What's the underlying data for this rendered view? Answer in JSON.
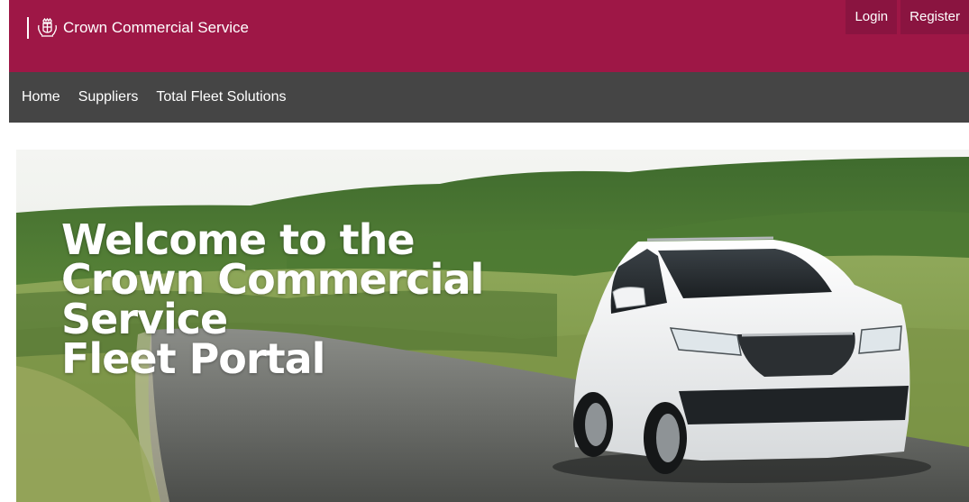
{
  "header": {
    "brand_name": "Crown Commercial Service",
    "brand_icon": "royal-crest-icon",
    "login_label": "Login",
    "register_label": "Register"
  },
  "nav": {
    "items": [
      {
        "label": "Home"
      },
      {
        "label": "Suppliers"
      },
      {
        "label": "Total Fleet Solutions"
      }
    ]
  },
  "hero": {
    "title_lines": [
      "Welcome to the",
      "Crown Commercial",
      "Service",
      "Fleet Portal"
    ],
    "image": "white-suv-on-country-road"
  },
  "colors": {
    "brand": "#9e1746",
    "nav_background": "#454545",
    "auth_button": "#8a1440"
  }
}
